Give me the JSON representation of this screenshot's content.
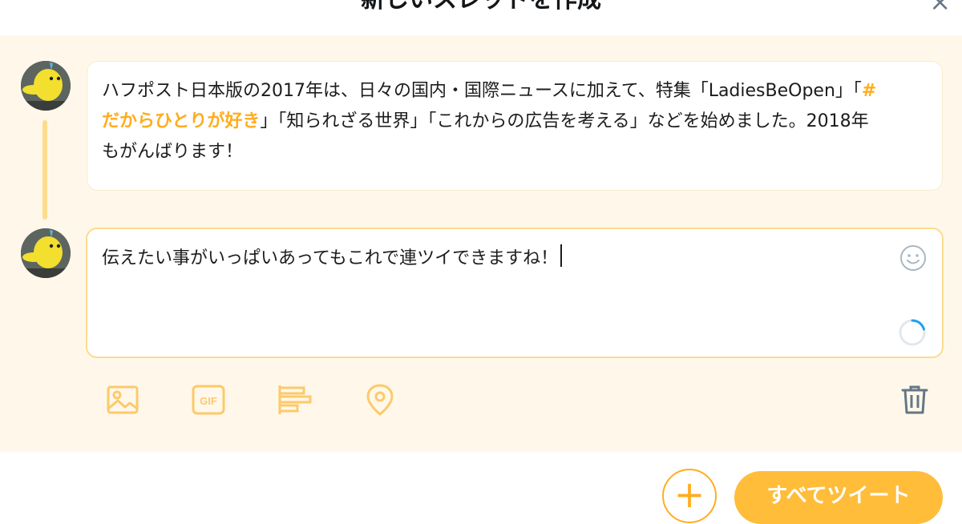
{
  "dialog": {
    "title": "新しいスレッドを作成",
    "close_label": "×"
  },
  "tweets": [
    {
      "text_before": "ハフポスト日本版の2017年は、日々の国内・国際ニュースに加えて、特集「LadiesBeOpen」「",
      "hashtag": "#だからひとりが好き",
      "text_after": "」「知られざる世界」「これからの広告を考える」などを始めました。2018年もがんばります！"
    },
    {
      "text": "伝えたい事がいっぱいあってもこれで連ツイできますね！"
    }
  ],
  "toolbar": {
    "icons": [
      "image-icon",
      "gif-icon",
      "poll-icon",
      "location-icon",
      "trash-icon"
    ],
    "gif_label": "GIF"
  },
  "footer": {
    "add_label": "+",
    "tweet_all_label": "すべてツイート"
  },
  "colors": {
    "accent": "#ffad1f",
    "background": "#fff8ea",
    "thread_line": "#fddb8d"
  }
}
